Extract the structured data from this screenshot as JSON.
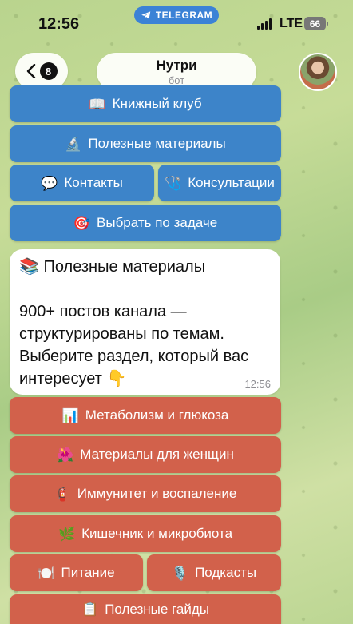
{
  "status_bar": {
    "time": "12:56",
    "app_badge": "TELEGRAM",
    "network": "LTE",
    "battery": "66"
  },
  "header": {
    "back_count": "8",
    "chat_name": "Нутри",
    "chat_subtitle": "бот",
    "avatar_icon": "user-avatar"
  },
  "top_keyboard": [
    {
      "emoji": "📖",
      "label": "Книжный клуб"
    },
    {
      "emoji": "🔬",
      "label": "Полезные материалы"
    },
    {
      "emoji": "💬",
      "label": "Контакты"
    },
    {
      "emoji": "🩺",
      "label": "Консультации"
    },
    {
      "emoji": "🎯",
      "label": "Выбрать по задаче"
    }
  ],
  "message": {
    "lines": [
      "📚 Полезные материалы",
      "900+ постов канала —",
      "структурированы по темам.",
      "Выберите раздел, который вас",
      "интересует 👇"
    ],
    "time": "12:56"
  },
  "inline_keyboard": [
    {
      "emoji": "📊",
      "label": "Метаболизм и глюкоза"
    },
    {
      "emoji": "🌺",
      "label": "Материалы для женщин"
    },
    {
      "emoji": "🧯",
      "label": "Иммунитет и воспаление"
    },
    {
      "emoji": "🌿",
      "label": "Кишечник и микробиота"
    },
    {
      "emoji": "🍽️",
      "label": "Питание"
    },
    {
      "emoji": "🎙️",
      "label": "Подкасты"
    },
    {
      "emoji": "📋",
      "label": "Полезные гайды"
    }
  ],
  "colors": {
    "keyboard_blue": "#3d84c9",
    "inline_red": "#d2614b",
    "telegram_blue": "#3b82d6"
  }
}
